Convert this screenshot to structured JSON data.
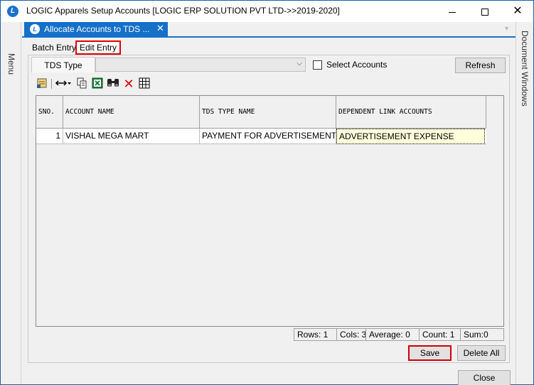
{
  "window": {
    "title": "LOGIC Apparels Setup Accounts  [LOGIC ERP SOLUTION PVT LTD->>2019-2020]",
    "app_icon": "logic-logo-icon"
  },
  "side_panels": {
    "left_label": "Menu",
    "right_label": "Document Windows"
  },
  "doc_tab": {
    "label": "Allocate Accounts to TDS ...",
    "close": "✕"
  },
  "subtabs": {
    "batch": "Batch Entry",
    "edit": "Edit Entry"
  },
  "filter": {
    "tds_type_label": "TDS Type",
    "tds_type_value": "",
    "select_accounts_label": "Select Accounts",
    "select_accounts_checked": false,
    "refresh_label": "Refresh"
  },
  "toolbar": {
    "icons": [
      "notes-icon",
      "column-width-icon",
      "copy-icon",
      "excel-icon",
      "find-icon",
      "delete-icon",
      "grid-icon"
    ]
  },
  "grid": {
    "columns": [
      "SNO.",
      "ACCOUNT NAME",
      "TDS TYPE NAME",
      "DEPENDENT LINK ACCOUNTS"
    ],
    "rows": [
      {
        "sno": "1",
        "account": "VISHAL MEGA MART",
        "tds_type": "PAYMENT FOR ADVERTISEMENT",
        "dependent": "ADVERTISEMENT EXPENSE"
      }
    ]
  },
  "status": {
    "rows": "Rows: 1",
    "cols": "Cols: 3",
    "average": "Average: 0",
    "count": "Count: 1",
    "sum": "Sum:0"
  },
  "buttons": {
    "save": "Save",
    "delete_all": "Delete All",
    "close": "Close"
  },
  "colors": {
    "accent": "#1570c8",
    "highlight_border": "#e00000",
    "active_cell": "#ffffdc"
  }
}
